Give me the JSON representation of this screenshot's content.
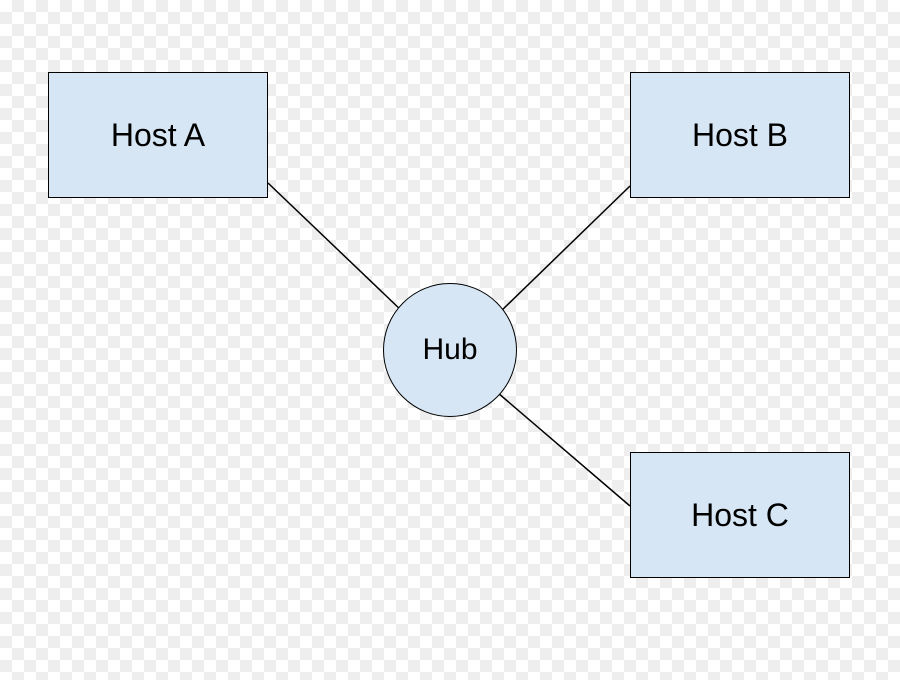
{
  "diagram": {
    "type": "network-topology",
    "topology": "star",
    "hub": {
      "label": "Hub",
      "shape": "circle",
      "fill": "#d7e6f4",
      "stroke": "#000000"
    },
    "hosts": [
      {
        "id": "A",
        "label": "Host A",
        "shape": "rectangle",
        "fill": "#d7e6f4",
        "stroke": "#000000"
      },
      {
        "id": "B",
        "label": "Host B",
        "shape": "rectangle",
        "fill": "#d7e6f4",
        "stroke": "#000000"
      },
      {
        "id": "C",
        "label": "Host C",
        "shape": "rectangle",
        "fill": "#d7e6f4",
        "stroke": "#000000"
      }
    ],
    "edges": [
      {
        "from": "hub",
        "to": "A"
      },
      {
        "from": "hub",
        "to": "B"
      },
      {
        "from": "hub",
        "to": "C"
      }
    ]
  }
}
